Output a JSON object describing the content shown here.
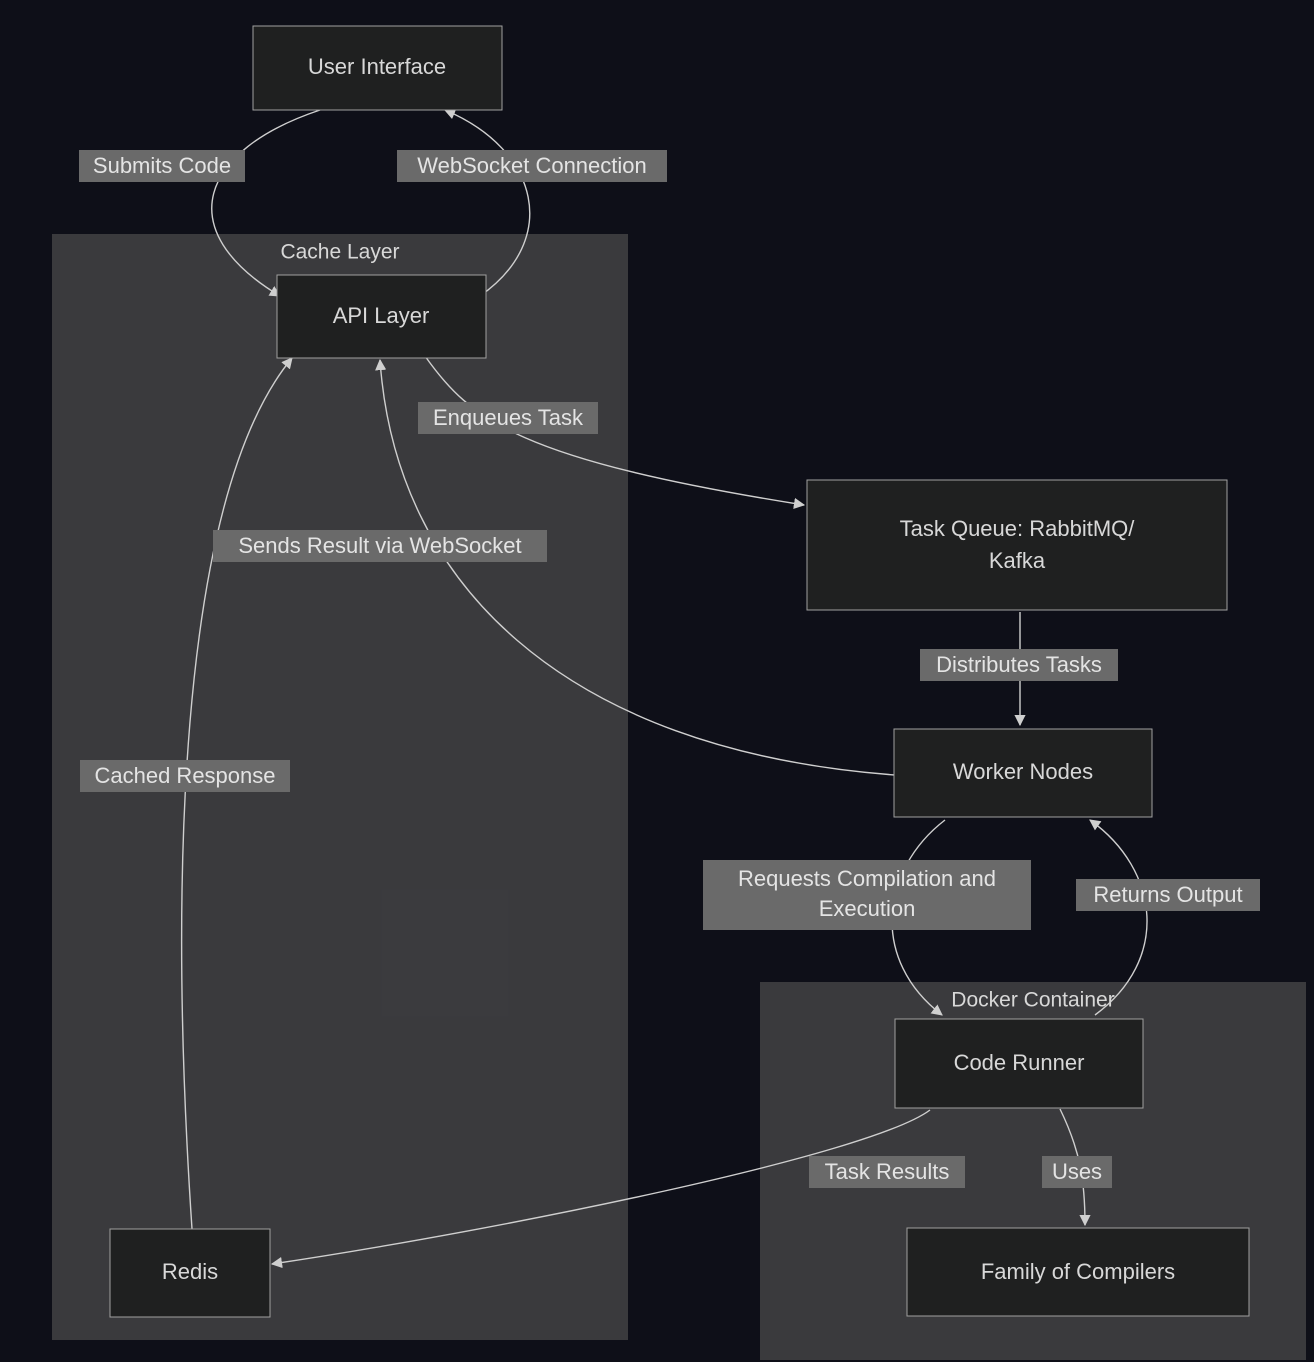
{
  "diagram": {
    "groups": {
      "cache": {
        "title": "Cache Layer"
      },
      "docker": {
        "title": "Docker Container"
      }
    },
    "nodes": {
      "ui": {
        "label": "User Interface"
      },
      "api": {
        "label": "API Layer"
      },
      "queue": {
        "label1": "Task Queue: RabbitMQ/",
        "label2": "Kafka"
      },
      "workers": {
        "label": "Worker Nodes"
      },
      "runner": {
        "label": "Code Runner"
      },
      "compilers": {
        "label": "Family of Compilers"
      },
      "redis": {
        "label": "Redis"
      }
    },
    "edges": {
      "submits": {
        "label": "Submits Code"
      },
      "ws": {
        "label": "WebSocket Connection"
      },
      "enqueue": {
        "label": "Enqueues Task"
      },
      "sendsres": {
        "label": "Sends Result via WebSocket"
      },
      "cached": {
        "label": "Cached Response"
      },
      "dist": {
        "label": "Distributes Tasks"
      },
      "reqexec": {
        "label1": "Requests Compilation and",
        "label2": "Execution"
      },
      "returns": {
        "label": "Returns Output"
      },
      "taskres": {
        "label": "Task Results"
      },
      "uses": {
        "label": "Uses"
      }
    }
  }
}
